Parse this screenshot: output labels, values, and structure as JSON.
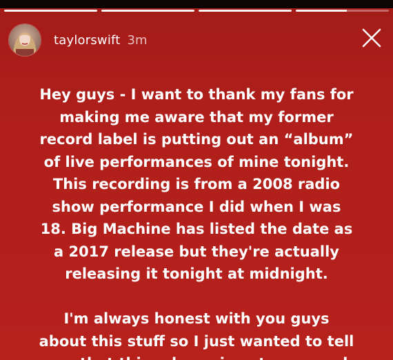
{
  "header": {
    "username": "taylorswift",
    "time": "3m",
    "avatar_icon": "profile-avatar",
    "close_icon": "close-icon"
  },
  "progress": {
    "segments": 4,
    "current": 4,
    "current_fraction": 0.55
  },
  "colors": {
    "background": "#b01f1b",
    "text": "#ffffff",
    "top_bar": "#0c0504"
  },
  "story": {
    "paragraph_1": [
      "Hey guys - I want to thank my fans for",
      "making me aware that my former",
      "record label is putting out an “album”",
      "of live performances of mine tonight.",
      "This recording is from a 2008 radio",
      "show performance I did when I was",
      "18. Big Machine has listed the date as",
      "a 2017 release but they're actually",
      "releasing it tonight at midnight."
    ],
    "paragraph_2": [
      "I'm always honest with you guys",
      "about this stuff so I just wanted to tell",
      "you that this release is not approved"
    ]
  }
}
